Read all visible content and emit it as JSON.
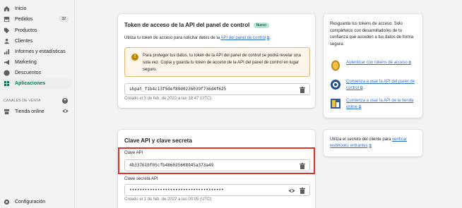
{
  "sidebar": {
    "items": [
      {
        "label": "Inicio",
        "icon": "home-icon"
      },
      {
        "label": "Pedidos",
        "icon": "orders-icon",
        "badge": "32"
      },
      {
        "label": "Productos",
        "icon": "tag-icon"
      },
      {
        "label": "Clientes",
        "icon": "customer-icon"
      },
      {
        "label": "Informes y estadísticas",
        "icon": "analytics-icon"
      },
      {
        "label": "Marketing",
        "icon": "megaphone-icon"
      },
      {
        "label": "Descuentos",
        "icon": "discount-icon"
      },
      {
        "label": "Aplicaciones",
        "icon": "apps-icon",
        "active": true
      }
    ],
    "channels_title": "CANALES DE VENTA",
    "channel": "Tienda online",
    "settings": "Configuración"
  },
  "token_card": {
    "title": "Token de acceso de la API del panel de control",
    "badge": "Nuevo",
    "intro": "Utiliza tu token de acceso para solicitar datos de la",
    "intro_link": "API del panel de control",
    "intro_end": ".",
    "warning": "Para proteger tus datos, tu token de la API del panel de control se podrá revelar una sola vez. Copia y guarda tu token de acceso de la API del panel de control en lugar seguro.",
    "token_value": "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",
    "created": "Creado el 3 de feb. de 2022 a las 18:47 (UTC)"
  },
  "token_aside": {
    "text": "Resguarda tus tokens de acceso. Solo compártelos con desarrolladores de tu confianza que acceden a tus datos de forma segura.",
    "links": [
      {
        "label": "Autenticar con tokens de acceso",
        "icon": "token-coin-icon"
      },
      {
        "label": "Comienza a usar la API del panel de control",
        "icon": "gear-graphql-icon"
      },
      {
        "label": "Comienza a usar la API de la tienda online",
        "icon": "storefront-icon"
      }
    ]
  },
  "key_card": {
    "title": "Clave API y clave secreta",
    "api_key_label": "Clave API",
    "api_key_value": "4b33761bf05cfb486035608945a373a49",
    "secret_label": "Clave secreta API",
    "secret_value": "•••••••••••••••••••••••••••••••••••••",
    "created": "Creado el 1 de feb. de 2022 a las 00:05 (UTC)"
  },
  "key_aside": {
    "text": "Utiliza el secreto del cliente para",
    "link": "verificar webhooks entrantes"
  },
  "ext_glyph": "⧉",
  "colors": {
    "accent": "#008060",
    "link": "#2c6ecb",
    "highlight": "#d9342b",
    "warning_bg": "#fff5ea"
  }
}
